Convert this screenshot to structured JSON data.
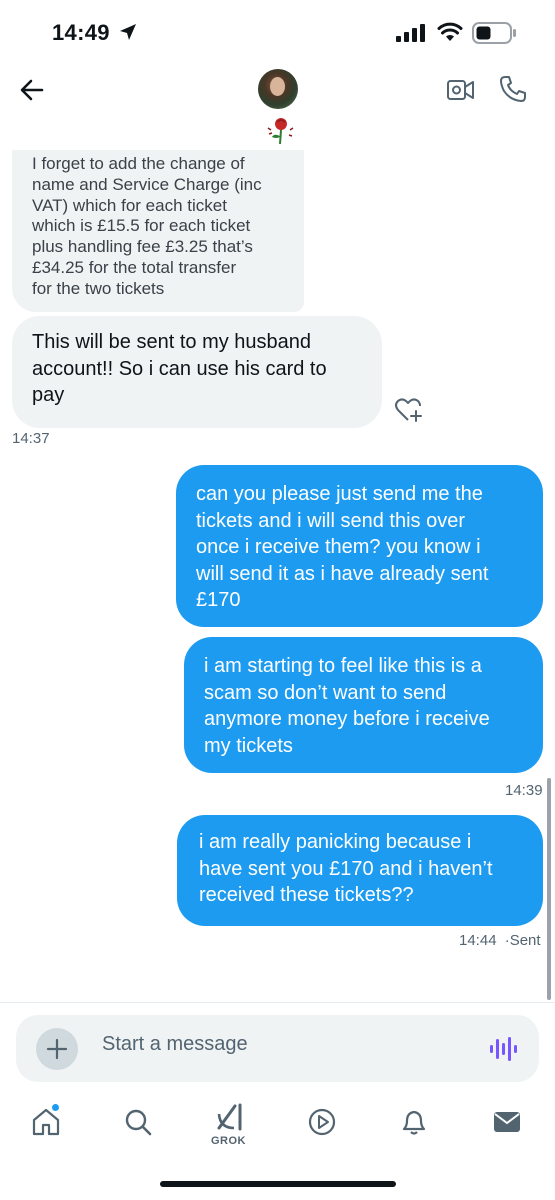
{
  "status_bar": {
    "time": "14:49",
    "icons": [
      "location-arrow-icon",
      "cellular-signal-icon",
      "wifi-icon",
      "battery-icon"
    ]
  },
  "header": {
    "back_icon": "back-arrow-icon",
    "avatar": "profile-avatar",
    "display_name_emoji": "rose-emoji",
    "actions": [
      "video-call-icon",
      "phone-call-icon"
    ]
  },
  "messages": [
    {
      "direction": "received",
      "lines": [
        "I forget to add the change of",
        "name and Service Charge (inc",
        "VAT) which for each ticket",
        "which is £15.5 for each ticket",
        "plus handling fee £3.25 that’s",
        "£34.25  for the total transfer",
        "for the two tickets"
      ]
    },
    {
      "direction": "received",
      "lines": [
        "This will be sent to my husband",
        "account!! So i can use his card to",
        "pay"
      ]
    },
    {
      "timestamp": "14:37"
    },
    {
      "direction": "sent",
      "lines": [
        "can you please just send me the",
        "tickets and i will send this over",
        "once i receive them? you know i",
        "will send it as i have already sent",
        "£170"
      ]
    },
    {
      "direction": "sent",
      "lines": [
        "i am starting to feel like this is a",
        "scam so don’t want to send",
        "anymore money before i receive",
        "my tickets"
      ]
    },
    {
      "timestamp": "14:39"
    },
    {
      "direction": "sent",
      "lines": [
        "i am really panicking because i",
        "have sent you £170 and i haven’t",
        "received these tickets??"
      ]
    },
    {
      "timestamp": "14:44",
      "status": "·Sent"
    }
  ],
  "composer": {
    "placeholder": "Start a message",
    "icons": [
      "add-media-icon",
      "voice-message-icon"
    ]
  },
  "tab_bar": {
    "tabs": [
      "home-icon",
      "search-icon",
      "grok-icon",
      "video-icon",
      "notifications-icon",
      "messages-icon"
    ],
    "grok_label": "GROK"
  },
  "colors": {
    "accent": "#1d9bf0",
    "received_bubble": "#eff3f4",
    "voice_icon": "#7856ff",
    "secondary_text": "#536471"
  }
}
